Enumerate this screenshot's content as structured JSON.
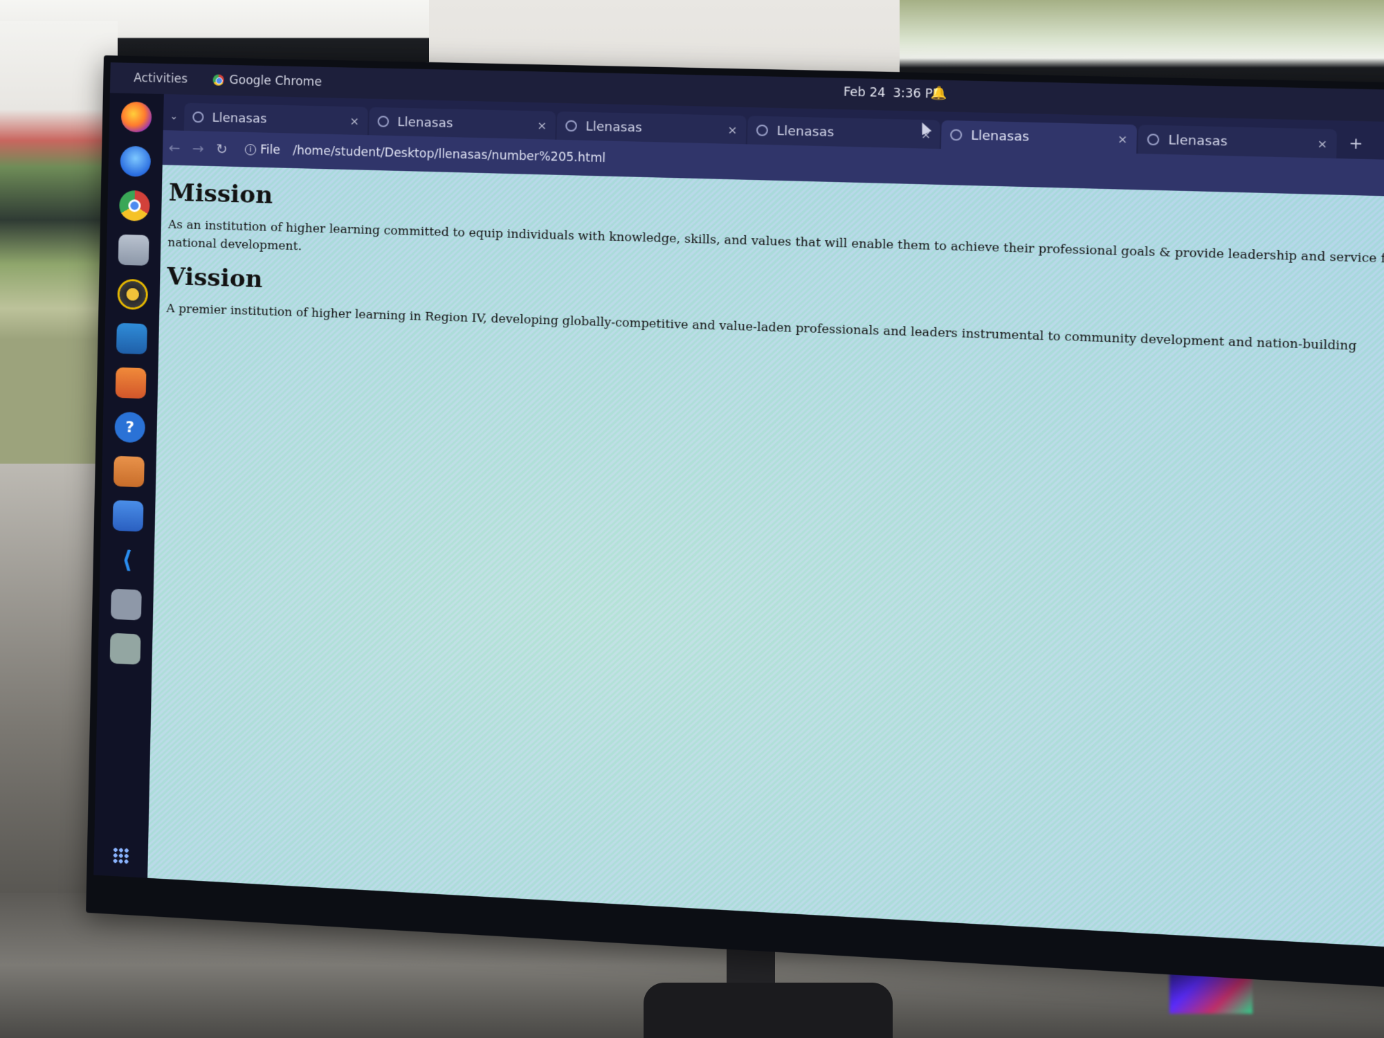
{
  "gnome": {
    "activities": "Activities",
    "app_name": "Google Chrome",
    "date": "Feb 24",
    "time": "3:36 PM"
  },
  "dock": {
    "items": [
      {
        "name": "firefox-icon"
      },
      {
        "name": "thunderbird-icon"
      },
      {
        "name": "chrome-icon"
      },
      {
        "name": "files-icon"
      },
      {
        "name": "rhythmbox-icon"
      },
      {
        "name": "writer-icon"
      },
      {
        "name": "software-icon"
      },
      {
        "name": "help-icon",
        "glyph": "?"
      },
      {
        "name": "document-viewer-icon"
      },
      {
        "name": "text-editor-icon"
      },
      {
        "name": "vscode-icon"
      },
      {
        "name": "blank-app-icon"
      },
      {
        "name": "trash-icon"
      }
    ]
  },
  "chrome": {
    "tabs": [
      {
        "title": "Llenasas",
        "close": "×"
      },
      {
        "title": "Llenasas",
        "close": "×"
      },
      {
        "title": "Llenasas",
        "close": "×"
      },
      {
        "title": "Llenasas",
        "close": "×"
      },
      {
        "title": "Llenasas",
        "close": "×"
      },
      {
        "title": "Llenasas",
        "close": "×"
      }
    ],
    "new_tab": "+",
    "omnibox": {
      "scheme": "File",
      "url": "/home/student/Desktop/llenasas/number%205.html"
    }
  },
  "page": {
    "mission_heading": "Mission",
    "mission_text": "As an institution of higher learning committed to equip individuals with knowledge, skills, and values that will enable them to achieve their professional goals & provide leadership and service for national development.",
    "vision_heading": "Vission",
    "vision_text": "A premier institution of higher learning in Region IV, developing globally-competitive and value-laden professionals and leaders instrumental to community development and nation-building"
  }
}
